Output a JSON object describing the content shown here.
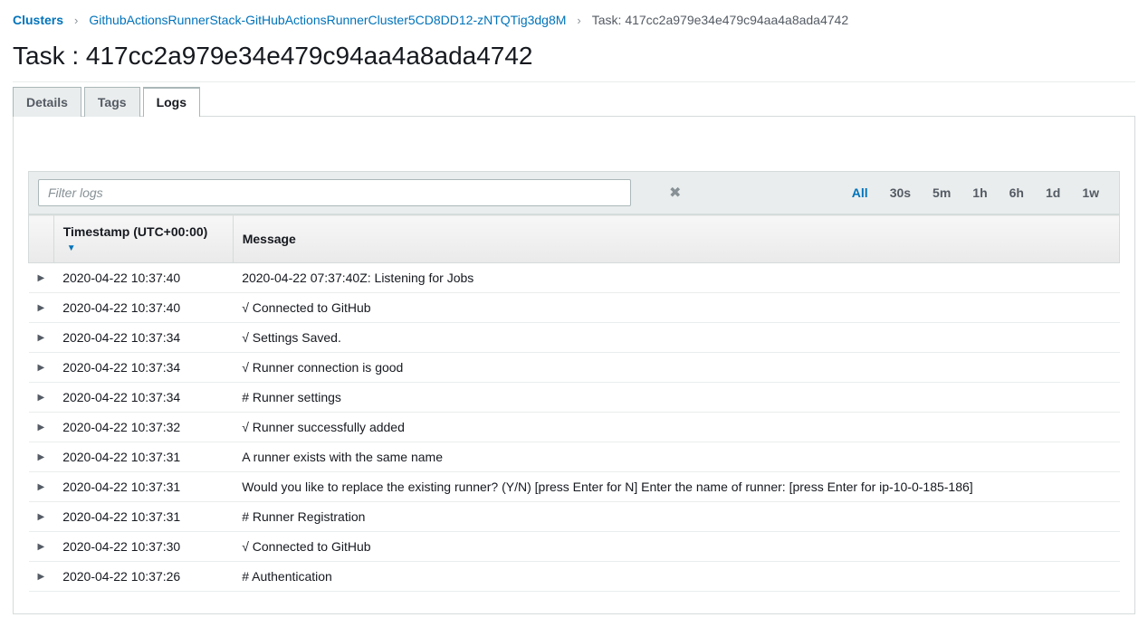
{
  "breadcrumb": {
    "clusters": "Clusters",
    "cluster_name": "GithubActionsRunnerStack-GitHubActionsRunnerCluster5CD8DD12-zNTQTig3dg8M",
    "current": "Task: 417cc2a979e34e479c94aa4a8ada4742"
  },
  "page_title": "Task : 417cc2a979e34e479c94aa4a8ada4742",
  "tabs": {
    "details": "Details",
    "tags": "Tags",
    "logs": "Logs"
  },
  "filter": {
    "placeholder": "Filter logs"
  },
  "time_ranges": {
    "all": "All",
    "r30s": "30s",
    "r5m": "5m",
    "r1h": "1h",
    "r6h": "6h",
    "r1d": "1d",
    "r1w": "1w"
  },
  "columns": {
    "timestamp": "Timestamp (UTC+00:00)",
    "message": "Message"
  },
  "logs": [
    {
      "ts": "2020-04-22 10:37:40",
      "msg": "2020-04-22 07:37:40Z: Listening for Jobs"
    },
    {
      "ts": "2020-04-22 10:37:40",
      "msg": "√ Connected to GitHub"
    },
    {
      "ts": "2020-04-22 10:37:34",
      "msg": "√ Settings Saved."
    },
    {
      "ts": "2020-04-22 10:37:34",
      "msg": "√ Runner connection is good"
    },
    {
      "ts": "2020-04-22 10:37:34",
      "msg": "# Runner settings"
    },
    {
      "ts": "2020-04-22 10:37:32",
      "msg": "√ Runner successfully added"
    },
    {
      "ts": "2020-04-22 10:37:31",
      "msg": "A runner exists with the same name"
    },
    {
      "ts": "2020-04-22 10:37:31",
      "msg": "Would you like to replace the existing runner? (Y/N) [press Enter for N] Enter the name of runner: [press Enter for ip-10-0-185-186]"
    },
    {
      "ts": "2020-04-22 10:37:31",
      "msg": "# Runner Registration"
    },
    {
      "ts": "2020-04-22 10:37:30",
      "msg": "√ Connected to GitHub"
    },
    {
      "ts": "2020-04-22 10:37:26",
      "msg": "# Authentication"
    }
  ]
}
